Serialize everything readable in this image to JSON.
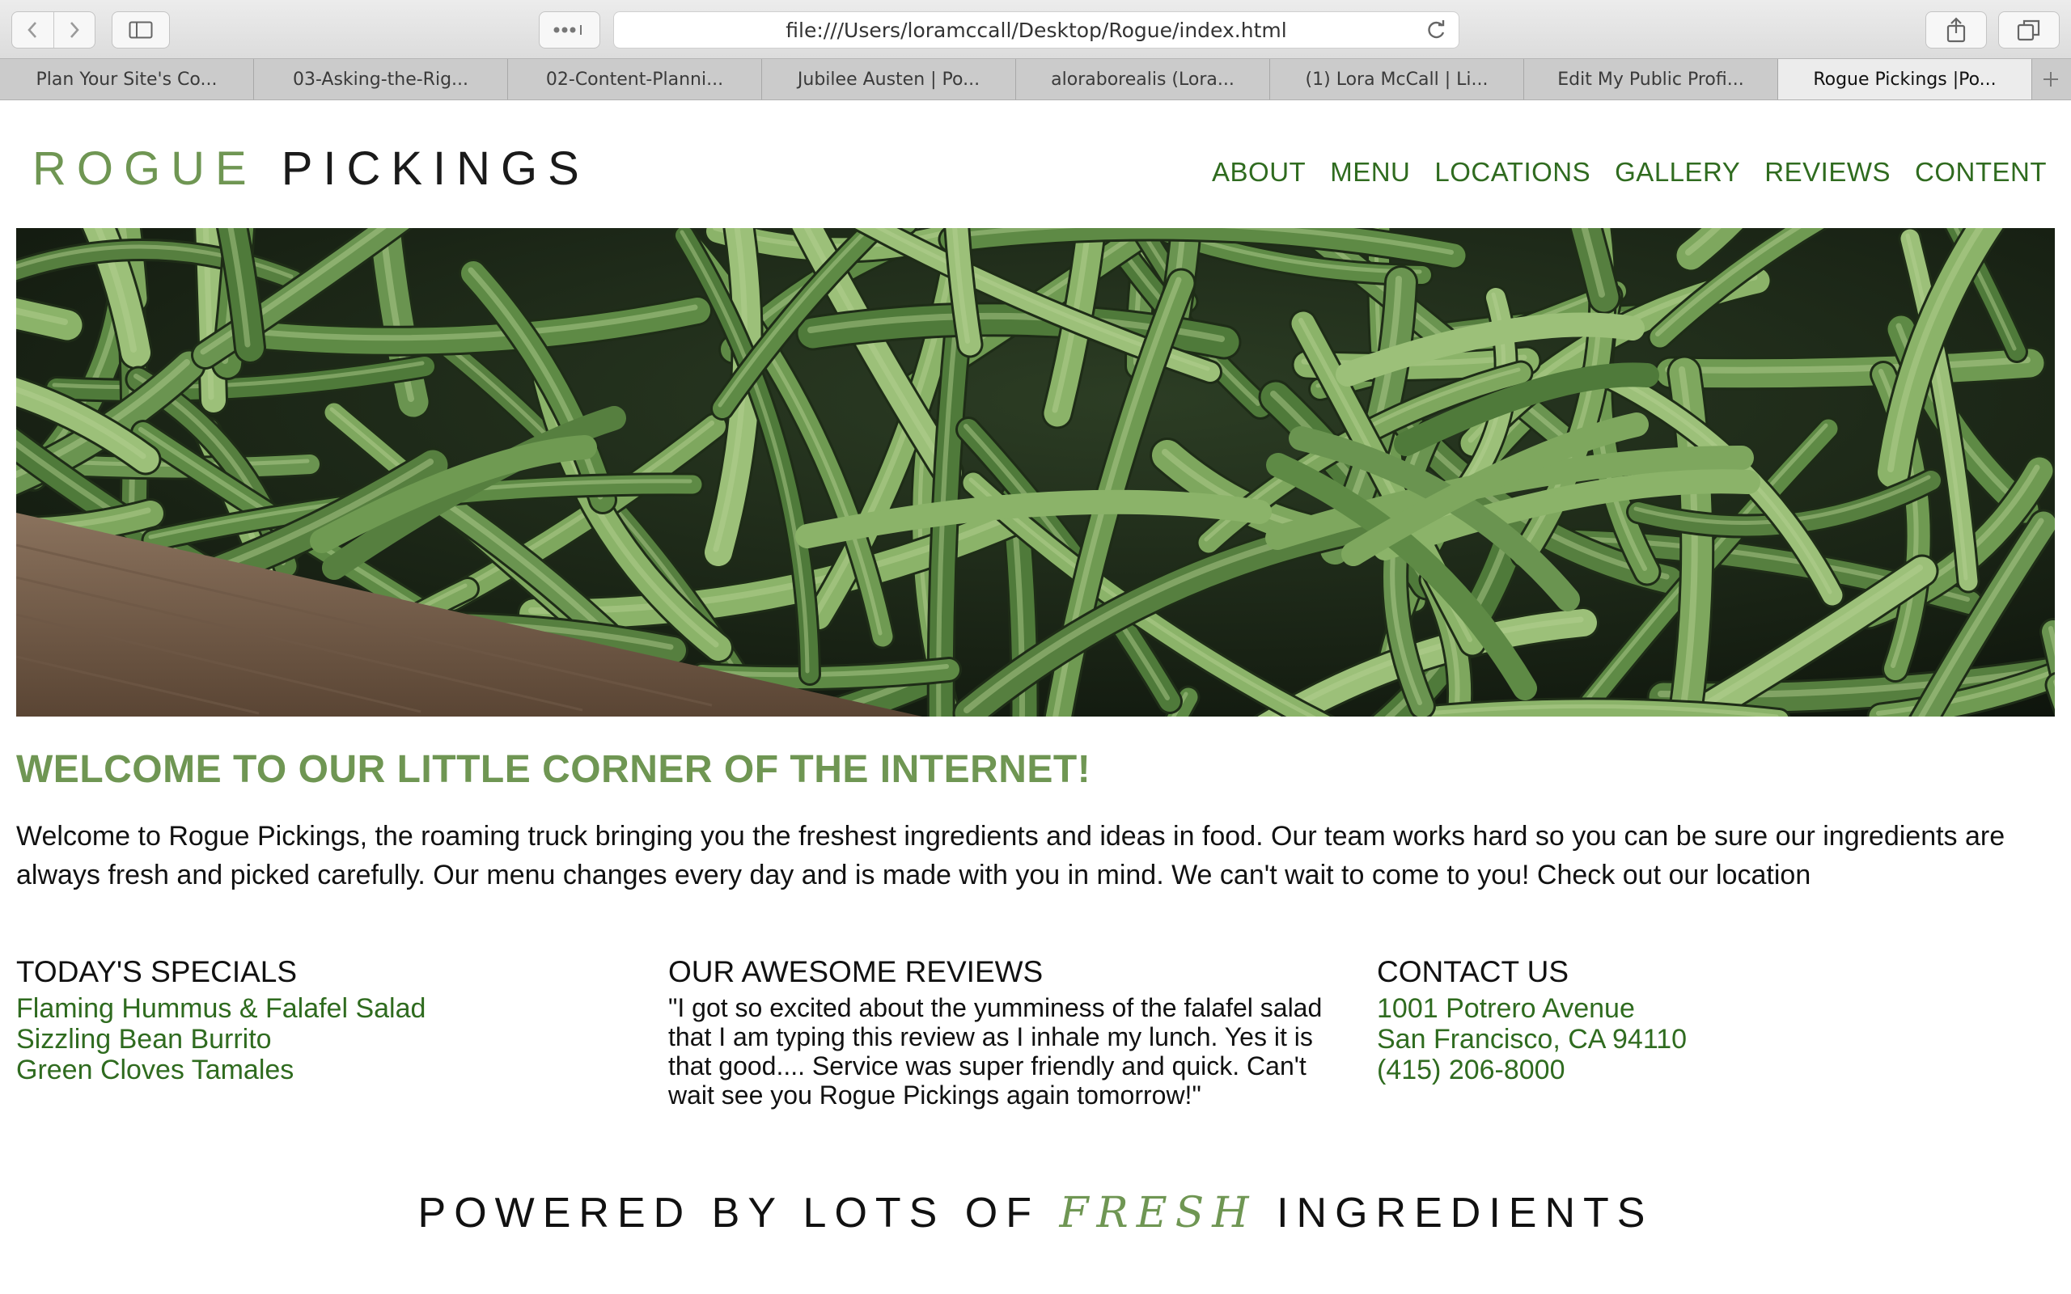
{
  "browser": {
    "url": "file:///Users/loramccall/Desktop/Rogue/index.html",
    "tabs": [
      {
        "label": "Plan Your Site's Co..."
      },
      {
        "label": "03-Asking-the-Rig..."
      },
      {
        "label": "02-Content-Planni..."
      },
      {
        "label": "Jubilee Austen | Po..."
      },
      {
        "label": "aloraborealis (Lora..."
      },
      {
        "label": "(1) Lora McCall | Li..."
      },
      {
        "label": "Edit My Public Profi..."
      },
      {
        "label": "Rogue Pickings |Po..."
      }
    ],
    "active_tab_index": 7
  },
  "site": {
    "logo_part1": "ROGUE",
    "logo_part2": "PICKINGS",
    "nav": [
      "ABOUT",
      "MENU",
      "LOCATIONS",
      "GALLERY",
      "REVIEWS",
      "CONTENT"
    ],
    "hero_image": "green-beans-photo",
    "welcome_heading": "WELCOME TO OUR LITTLE CORNER OF THE INTERNET!",
    "intro": "Welcome to Rogue Pickings, the roaming truck bringing you the freshest ingredients and ideas in food. Our team works hard so you can be sure our ingredients are always fresh and picked carefully. Our menu changes every day and is made with you in mind. We can't wait to come to you! Check out our location",
    "specials": {
      "heading": "TODAY'S SPECIALS",
      "items": [
        "Flaming Hummus & Falafel Salad",
        "Sizzling Bean Burrito",
        "Green Cloves Tamales"
      ]
    },
    "reviews": {
      "heading": "OUR AWESOME REVIEWS",
      "quote": "\"I got so excited about the yumminess of the falafel salad that I am typing this review as I inhale my lunch. Yes it is that good.... Service was super friendly and quick. Can't wait see you Rogue Pickings again tomorrow!\""
    },
    "contact": {
      "heading": "CONTACT US",
      "street": "1001 Potrero Avenue",
      "city": "San Francisco, CA 94110",
      "phone": "(415) 206-8000"
    },
    "footer": {
      "pre": "POWERED BY LOTS OF",
      "accent": "FRESH",
      "post": "INGREDIENTS"
    }
  },
  "colors": {
    "brand_green_light": "#6f9653",
    "brand_green_dark": "#2f6b1f",
    "text": "#111111"
  }
}
